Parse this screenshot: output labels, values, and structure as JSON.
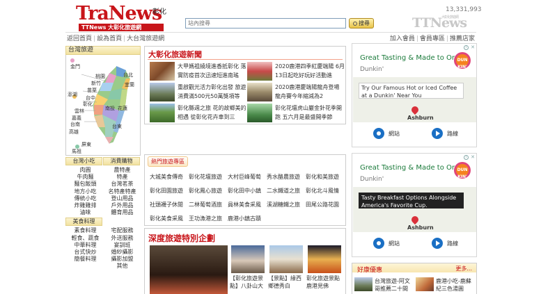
{
  "header": {
    "logo_main": "TraNews",
    "logo_region": "彰化",
    "logo_sub": "TTNews 大彰化旅遊網",
    "visit_count": "13,331,993",
    "ttn_logo": "TTNews",
    "ttn_logo_small": "大彰化旅遊網",
    "search_placeholder": "站內搜尋",
    "search_button": "搜尋",
    "nav_left": [
      "返回首頁",
      "設為首頁",
      "大台灣旅遊網"
    ],
    "nav_right": [
      "加入會員",
      "會員專區",
      "推薦店家"
    ]
  },
  "left": {
    "map_title": "台灣旅遊",
    "map_labels": [
      "金門",
      "桃園",
      "台北",
      "宜蘭",
      "新竹",
      "苗栗",
      "澎湖",
      "台中",
      "彰化",
      "南投",
      "花蓮",
      "雲林",
      "嘉義",
      "台南",
      "台東",
      "高雄",
      "屏東",
      "馬祖"
    ],
    "sub_heads_1": [
      "台灣小吃",
      "消費購物"
    ],
    "col1": [
      "台灣小吃",
      "肉圓",
      "牛肉麵",
      "麵包飯頭",
      "地方小吃",
      "傳統小吃",
      "炸雞雞排",
      "滷味"
    ],
    "col2": [
      "農特產",
      "特產",
      "台灣茗茶",
      "名特產特產",
      "登山用品",
      "戶外用品",
      "體育用品",
      "寵物用品",
      "寵物飼"
    ],
    "sub_heads_2": [
      "美食料理",
      "消費購物2"
    ],
    "col3": [
      "美食料理",
      "素食料理",
      "輕食、蔬食",
      "中華料理",
      "台式快炒",
      "簡餐料理",
      "觀光休閒",
      "下午茶",
      "甜點"
    ],
    "col4": [
      "宅配服務",
      "外送服務",
      "宴訓班",
      "婚紗攝影",
      "攝影加盟",
      "其他",
      "觀光休閒",
      "國民旅遊卡",
      "開會住宿"
    ]
  },
  "news": {
    "title": "大彰化旅遊新聞",
    "items": [
      {
        "text": "大甲媽祖繞境進香抵彰化 落實防疫首次迅速短進南瑤"
      },
      {
        "text": "2020鹿港四季紅慶端陽 6月13日起吃好玩好活動進"
      },
      {
        "text": "重啟觀光活力彰化出發 旅遊消費滿500元50萬獎項等"
      },
      {
        "text": "2020鹿港慶端陽龍舟登場 龍舟賽今年縮減為2"
      },
      {
        "text": "彰化縣週之旅 花的故鄉美的相遇 從彰化花卉車到三"
      },
      {
        "text": "彰化花壇虎山巖金針花季開跑 五六月是最盛開季節"
      }
    ]
  },
  "popular": {
    "title": "熱門旅遊專區",
    "rows": [
      [
        "大城美食傳奇",
        "彰化花壇旅遊",
        "大村巨峰葡萄",
        "秀水酪農旅遊",
        "彰化和美旅遊"
      ],
      [
        "彰化田園旅遊",
        "彰化鳳心旅遊",
        "彰化田中小鎮",
        "二水鐵道之旅",
        "彰化北斗風情"
      ],
      [
        "社頭襪子休閒",
        "二林葡萄酒旅",
        "員林美食采風",
        "溪湖糖鐵之旅",
        "田尾公路花園"
      ],
      [
        "彰化美食采風",
        "王功漁港之旅",
        "鹿港小鎮古蹟"
      ]
    ]
  },
  "deep": {
    "title": "深度旅遊特別企劃",
    "captions": [
      "【彰化旅遊景點】八卦山大",
      "【景點】緣西鄉德秀白",
      "彰化旅遊景點 鹿港見佛"
    ]
  },
  "ads": [
    {
      "title": "Great Tasting & Made to Order",
      "brand": "Dunkin'",
      "logo": "DUN KIN'",
      "card": "Try Our Famous Hot or Iced Coffee at a Dunkin' Near You",
      "card_dark": false,
      "place": "Ashburn",
      "btn1": "網站",
      "btn2": "路線"
    },
    {
      "title": "Great Tasting & Made to Order",
      "brand": "Dunkin'",
      "logo": "DUN KIN'",
      "card": "Tasty Breakfast Options Alongside America's Favorite Cup.",
      "card_dark": true,
      "place": "Ashburn",
      "btn1": "網站",
      "btn2": "路線"
    }
  ],
  "goods": {
    "title": "好康優惠",
    "more": "更多...",
    "items": [
      {
        "text": "台灣旅遊-阿文哥推薦二十間"
      },
      {
        "text": "鹿港小吃-鹿蘇紀三色湯圓"
      }
    ]
  }
}
